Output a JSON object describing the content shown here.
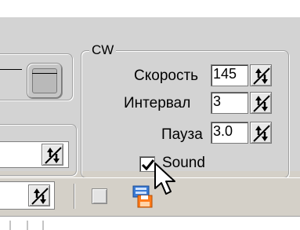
{
  "cw_group": {
    "title": "CW",
    "speed_label": "Скорость",
    "speed_value": "145",
    "interval_label": "Интервал",
    "interval_value": "3",
    "pause_label": "Пауза",
    "pause_value": "3.0",
    "sound_label": "Sound",
    "sound_checked": true
  },
  "icons": {
    "spinner": "spinner-arrows-icon",
    "save": "save-disk-icon",
    "cursor": "mouse-pointer-icon"
  }
}
